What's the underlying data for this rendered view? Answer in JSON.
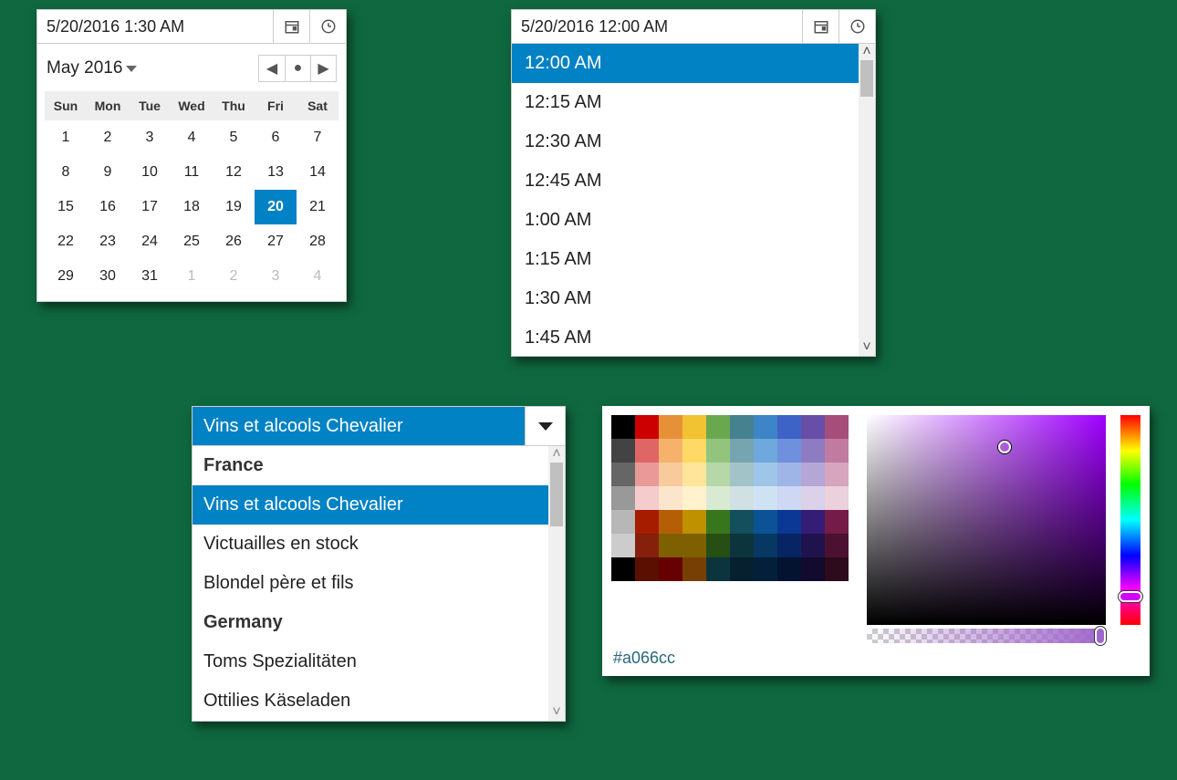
{
  "datetime1": {
    "value": "5/20/2016 1:30 AM",
    "month_label": "May 2016",
    "dow": [
      "Sun",
      "Mon",
      "Tue",
      "Wed",
      "Thu",
      "Fri",
      "Sat"
    ],
    "weeks": [
      [
        {
          "d": 1
        },
        {
          "d": 2
        },
        {
          "d": 3
        },
        {
          "d": 4
        },
        {
          "d": 5
        },
        {
          "d": 6
        },
        {
          "d": 7
        }
      ],
      [
        {
          "d": 8
        },
        {
          "d": 9
        },
        {
          "d": 10
        },
        {
          "d": 11
        },
        {
          "d": 12
        },
        {
          "d": 13
        },
        {
          "d": 14
        }
      ],
      [
        {
          "d": 15
        },
        {
          "d": 16
        },
        {
          "d": 17
        },
        {
          "d": 18
        },
        {
          "d": 19
        },
        {
          "d": 20,
          "sel": true
        },
        {
          "d": 21
        }
      ],
      [
        {
          "d": 22
        },
        {
          "d": 23
        },
        {
          "d": 24
        },
        {
          "d": 25
        },
        {
          "d": 26
        },
        {
          "d": 27
        },
        {
          "d": 28
        }
      ],
      [
        {
          "d": 29
        },
        {
          "d": 30
        },
        {
          "d": 31
        },
        {
          "d": 1,
          "other": true
        },
        {
          "d": 2,
          "other": true
        },
        {
          "d": 3,
          "other": true
        },
        {
          "d": 4,
          "other": true
        }
      ]
    ]
  },
  "datetime2": {
    "value": "5/20/2016 12:00 AM",
    "times": [
      {
        "t": "12:00 AM",
        "sel": true
      },
      {
        "t": "12:15 AM"
      },
      {
        "t": "12:30 AM"
      },
      {
        "t": "12:45 AM"
      },
      {
        "t": "1:00 AM"
      },
      {
        "t": "1:15 AM"
      },
      {
        "t": "1:30 AM"
      },
      {
        "t": "1:45 AM"
      }
    ]
  },
  "combo": {
    "value": "Vins et alcools Chevalier",
    "groups": [
      {
        "name": "France",
        "items": [
          "Vins et alcools Chevalier",
          "Victuailles en stock",
          "Blondel père et fils"
        ],
        "sel": 0
      },
      {
        "name": "Germany",
        "items": [
          "Toms Spezialitäten",
          "Ottilies Käseladen"
        ]
      }
    ]
  },
  "colorpicker": {
    "hex": "#a066cc",
    "palette": [
      [
        "#000000",
        "#cc0000",
        "#e69138",
        "#f1c232",
        "#6aa84f",
        "#45818e",
        "#3d85c6",
        "#3d63c6",
        "#674ea7",
        "#a64d79"
      ],
      [
        "#434343",
        "#e06666",
        "#f6b26b",
        "#ffd966",
        "#93c47d",
        "#76a5af",
        "#6fa8dc",
        "#6f90dc",
        "#8e7cc3",
        "#c27ba0"
      ],
      [
        "#666666",
        "#ea9999",
        "#f9cb9c",
        "#ffe599",
        "#b6d7a8",
        "#a2c4c9",
        "#9fc5e8",
        "#9fb5e8",
        "#b4a7d6",
        "#d5a6bd"
      ],
      [
        "#999999",
        "#f4cccc",
        "#fce5cd",
        "#fff2cc",
        "#d9ead3",
        "#d0e0e3",
        "#cfe2f3",
        "#cfd8f3",
        "#d9d2e9",
        "#ead1dc"
      ],
      [
        "#b7b7b7",
        "#a61c00",
        "#b45f06",
        "#bf9000",
        "#38761d",
        "#134f5c",
        "#0b5394",
        "#0b3894",
        "#351c75",
        "#741b47"
      ],
      [
        "#cccccc",
        "#85200c",
        "#7f6000",
        "#7f6000",
        "#274e13",
        "#0c343d",
        "#073763",
        "#072463",
        "#20124d",
        "#4c1130"
      ],
      [
        "#000000",
        "#5b0f00",
        "#660000",
        "#783f04",
        "#0c343d",
        "#062030",
        "#041f3a",
        "#041430",
        "#130b2e",
        "#2d0a1c"
      ]
    ]
  }
}
